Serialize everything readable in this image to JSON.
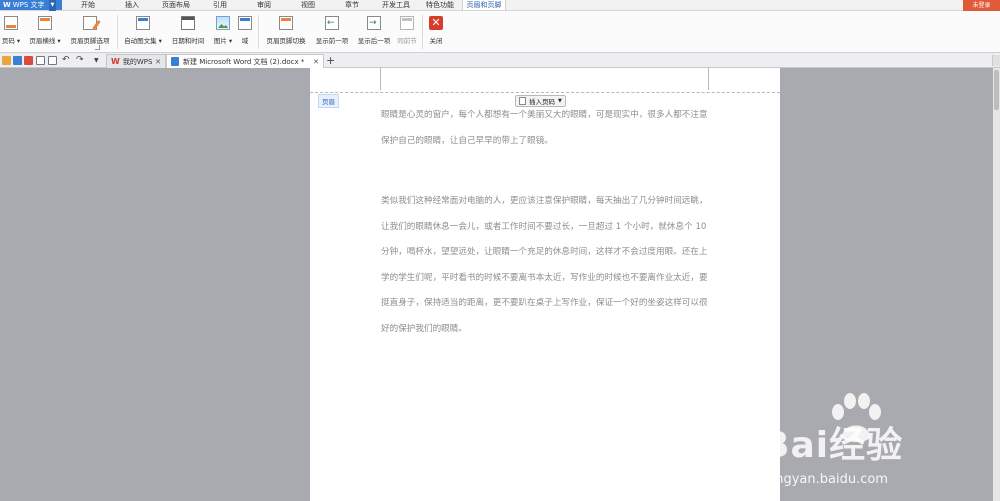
{
  "app": {
    "name": "WPS 文字",
    "login": "未登录"
  },
  "menu": {
    "tabs": [
      "开始",
      "插入",
      "页面布局",
      "引用",
      "审阅",
      "视图",
      "章节",
      "开发工具",
      "特色功能",
      "页眉和页脚"
    ],
    "active": "页眉和页脚"
  },
  "ribbon": {
    "page_number": "页码",
    "header_line": "页眉横线",
    "header_footer_options": "页眉页脚选项",
    "auto_text": "自动图文集",
    "date_time": "日期和时间",
    "picture": "图片",
    "field": "域",
    "switch_header_footer": "页眉页脚切换",
    "show_previous": "显示前一项",
    "show_next": "显示后一项",
    "same_as_previous": "同前节",
    "close": "关闭"
  },
  "tabs": {
    "my_wps": "我的WPS",
    "document": "新建 Microsoft Word 文档 (2).docx *",
    "new_tab": "+"
  },
  "document": {
    "header_label": "页眉",
    "insert_page_number": "插入页码",
    "paragraph1": "眼睛是心灵的窗户，每个人都想有一个美丽又大的眼睛，可是现实中，很多人都不注意保护自己的眼睛，让自己早早的带上了眼镜。",
    "paragraph2": "类似我们这种经常面对电脑的人，更应该注意保护眼睛，每天抽出了几分钟时间远眺，让我们的眼睛休息一会儿，或者工作时间不要过长，一旦超过 1 个小时，就休息个 10 分钟，喝杯水，望望远处，让眼睛一个充足的休息时间，这样才不会过度用眼。还在上学的学生们呢，平时看书的时候不要离书本太近，写作业的时候也不要离作业太近，要挺直身子，保持适当的距离，更不要趴在桌子上写作业，保证一个好的坐姿这样可以很好的保护我们的眼睛。"
  },
  "watermark": {
    "brand": "Bai经验",
    "url": "jingyan.baidu.com"
  },
  "colors": {
    "accent": "#3a7fd6",
    "login": "#e05a3a",
    "close": "#d63b2c"
  }
}
